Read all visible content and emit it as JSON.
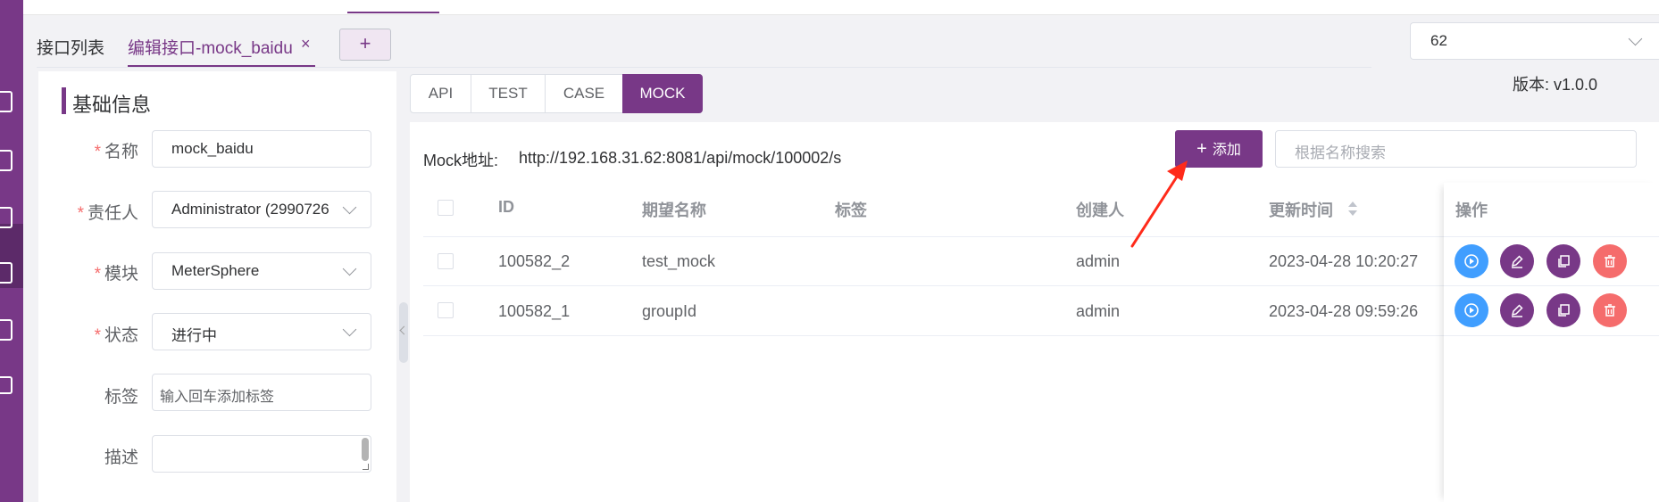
{
  "tabs": {
    "list_label": "接口列表",
    "edit_label": "编辑接口-mock_baidu",
    "close_glyph": "×",
    "add_glyph": "+"
  },
  "version": {
    "select_value": "62",
    "label": "版本: v1.0.0"
  },
  "form": {
    "section_title": "基础信息",
    "required_mark": "*",
    "name_label": "名称",
    "name_value": "mock_baidu",
    "owner_label": "责任人",
    "owner_value": "Administrator (2990726",
    "module_label": "模块",
    "module_value": "MeterSphere",
    "status_label": "状态",
    "status_value": "进行中",
    "tag_label": "标签",
    "tag_placeholder": "输入回车添加标签",
    "desc_label": "描述"
  },
  "subtabs": [
    "API",
    "TEST",
    "CASE",
    "MOCK"
  ],
  "mock": {
    "address_label": "Mock地址:",
    "address_url": "http://192.168.31.62:8081/api/mock/100002/s",
    "add_button_icon": "+",
    "add_button_label": "添加",
    "search_placeholder": "根据名称搜索"
  },
  "table": {
    "headers": [
      "ID",
      "期望名称",
      "标签",
      "创建人",
      "更新时间",
      "操作"
    ],
    "rows": [
      {
        "id": "100582_2",
        "name": "test_mock",
        "tag": "",
        "creator": "admin",
        "updated": "2023-04-28 10:20:27"
      },
      {
        "id": "100582_1",
        "name": "groupId",
        "tag": "",
        "creator": "admin",
        "updated": "2023-04-28 09:59:26"
      }
    ]
  },
  "icons": {
    "run": "play-circle-icon",
    "edit": "pencil-icon",
    "copy": "copy-icon",
    "delete": "trash-icon"
  },
  "colors": {
    "brand": "#783887",
    "run": "#409eff",
    "delete": "#f56c6c",
    "annotation_arrow": "#ff2a1a"
  }
}
